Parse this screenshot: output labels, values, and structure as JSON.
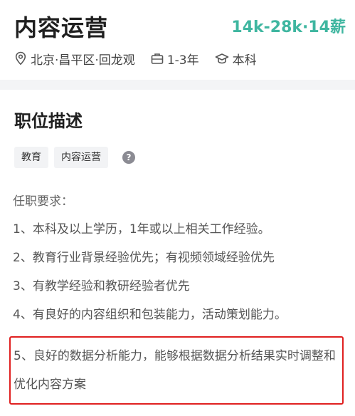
{
  "job": {
    "title": "内容运营",
    "salary": "14k-28k·14薪",
    "location": "北京·昌平区·回龙观",
    "experience": "1-3年",
    "education": "本科"
  },
  "description": {
    "section_title": "职位描述",
    "tags": [
      "教育",
      "内容运营"
    ],
    "help_symbol": "?",
    "requirements_label": "任职要求：",
    "requirements": [
      "1、本科及以上学历，1年或以上相关工作经验。",
      "2、教育行业背景经验优先；有视频领域经验优先",
      "3、有教学经验和教研经验者优先",
      "4、有良好的内容组织和包装能力，活动策划能力。",
      "5、良好的数据分析能力，能够根据数据分析结果实时调整和优化内容方案"
    ]
  },
  "colors": {
    "salary": "#3fb6a0",
    "highlight_border": "#e02020",
    "separator": "#f3f4f6"
  },
  "icons": [
    "location-pin-icon",
    "briefcase-icon",
    "graduation-cap-icon",
    "question-icon"
  ]
}
